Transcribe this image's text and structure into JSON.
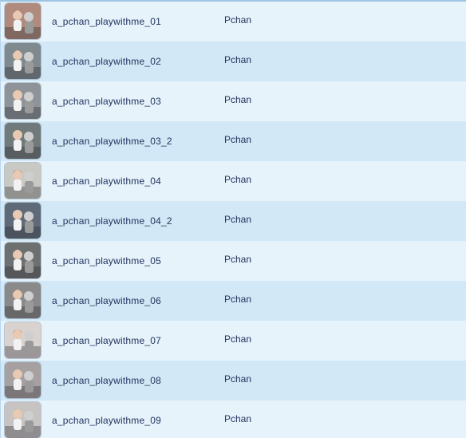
{
  "animations": [
    {
      "name": "a_pchan_playwithme_01",
      "creator": "Pchan",
      "thumbnail_icon": "portrait-thumbnail-icon",
      "tint": "#b08a7c"
    },
    {
      "name": "a_pchan_playwithme_02",
      "creator": "Pchan",
      "thumbnail_icon": "couple-thumbnail-icon",
      "tint": "#7f8a8e"
    },
    {
      "name": "a_pchan_playwithme_03",
      "creator": "Pchan",
      "thumbnail_icon": "couple-thumbnail-icon",
      "tint": "#8d9398"
    },
    {
      "name": "a_pchan_playwithme_03_2",
      "creator": "Pchan",
      "thumbnail_icon": "couple-thumbnail-icon",
      "tint": "#707a7a"
    },
    {
      "name": "a_pchan_playwithme_04",
      "creator": "Pchan",
      "thumbnail_icon": "room-thumbnail-icon",
      "tint": "#c9c9c4"
    },
    {
      "name": "a_pchan_playwithme_04_2",
      "creator": "Pchan",
      "thumbnail_icon": "couple-thumbnail-icon",
      "tint": "#5f6a78"
    },
    {
      "name": "a_pchan_playwithme_05",
      "creator": "Pchan",
      "thumbnail_icon": "couple-thumbnail-icon",
      "tint": "#6d7070"
    },
    {
      "name": "a_pchan_playwithme_06",
      "creator": "Pchan",
      "thumbnail_icon": "couple-thumbnail-icon",
      "tint": "#8a8a8a"
    },
    {
      "name": "a_pchan_playwithme_07",
      "creator": "Pchan",
      "thumbnail_icon": "pose-thumbnail-icon",
      "tint": "#d9d2cf"
    },
    {
      "name": "a_pchan_playwithme_08",
      "creator": "Pchan",
      "thumbnail_icon": "couple-thumbnail-icon",
      "tint": "#a7a0a0"
    },
    {
      "name": "a_pchan_playwithme_09",
      "creator": "Pchan",
      "thumbnail_icon": "couple-thumbnail-icon",
      "tint": "#c6c3c2"
    }
  ]
}
